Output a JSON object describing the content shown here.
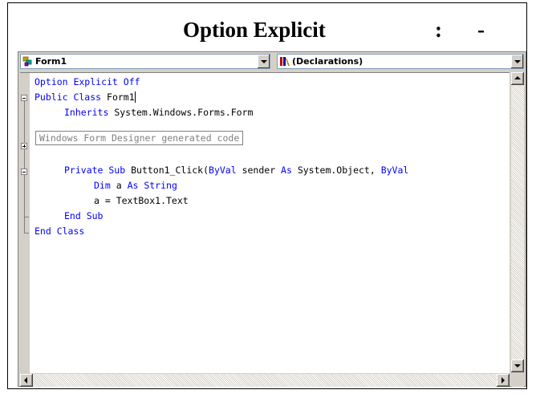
{
  "caption": {
    "title": "Option Explicit",
    "colon": ":",
    "dash": "-"
  },
  "toolbar": {
    "class_combo": {
      "value": "Form1",
      "icon": "class-icon"
    },
    "member_combo": {
      "value": "(Declarations)",
      "icon": "declarations-icon"
    }
  },
  "code": {
    "line1": {
      "kw1": "Option Explicit Off"
    },
    "line2": {
      "kw1": "Public Class",
      "text": " Form1"
    },
    "line3": {
      "kw1": "Inherits",
      "text": " System.Windows.Forms.Form"
    },
    "line4": {
      "region": "Windows Form Designer generated code"
    },
    "line5": {
      "kw1": "Private Sub",
      "text1": " Button1_Click(",
      "kw2": "ByVal",
      "text2": " sender ",
      "kw3": "As",
      "text3": " System.Object, ",
      "kw4": "ByVal"
    },
    "line6": {
      "kw1": "Dim",
      "text1": " a ",
      "kw2": "As String"
    },
    "line7": {
      "text": "a = TextBox1.Text"
    },
    "line8": {
      "kw1": "End Sub"
    },
    "line9": {
      "kw1": "End Class"
    }
  },
  "colors": {
    "keyword": "#0000ff",
    "region_text": "#808080",
    "chrome": "#d4d0c8"
  }
}
